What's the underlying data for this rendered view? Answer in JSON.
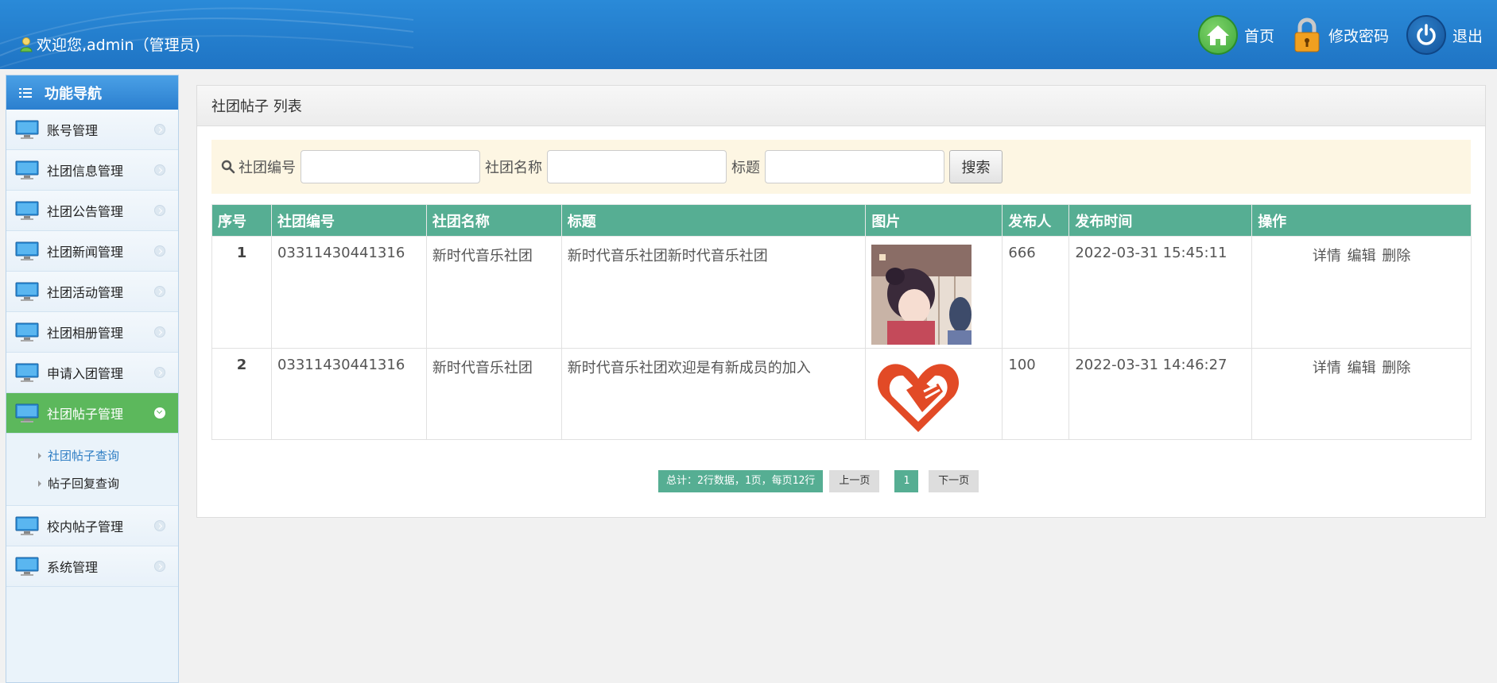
{
  "header": {
    "welcome": "欢迎您,admin（管理员)",
    "nav": [
      {
        "label": "首页",
        "icon": "home-icon"
      },
      {
        "label": "修改密码",
        "icon": "lock-icon"
      },
      {
        "label": "退出",
        "icon": "power-icon"
      }
    ]
  },
  "sidebar": {
    "title": "功能导航",
    "items": [
      {
        "label": "账号管理"
      },
      {
        "label": "社团信息管理"
      },
      {
        "label": "社团公告管理"
      },
      {
        "label": "社团新闻管理"
      },
      {
        "label": "社团活动管理"
      },
      {
        "label": "社团相册管理"
      },
      {
        "label": "申请入团管理"
      },
      {
        "label": "社团帖子管理"
      },
      {
        "label": "校内帖子管理"
      },
      {
        "label": "系统管理"
      }
    ],
    "sub_items": [
      {
        "label": "社团帖子查询"
      },
      {
        "label": "帖子回复查询"
      }
    ]
  },
  "panel": {
    "title": "社团帖子 列表"
  },
  "search": {
    "label_code": "社团编号",
    "label_name": "社团名称",
    "label_title": "标题",
    "value_code": "",
    "value_name": "",
    "value_title": "",
    "button": "搜索"
  },
  "table": {
    "headers": [
      "序号",
      "社团编号",
      "社团名称",
      "标题",
      "图片",
      "发布人",
      "发布时间",
      "操作"
    ],
    "rows": [
      {
        "idx": "1",
        "code": "03311430441316",
        "name": "新时代音乐社团",
        "title": "新时代音乐社团新时代音乐社团",
        "publisher": "666",
        "time": "2022-03-31 15:45:11"
      },
      {
        "idx": "2",
        "code": "03311430441316",
        "name": "新时代音乐社团",
        "title": "新时代音乐社团欢迎是有新成员的加入",
        "publisher": "100",
        "time": "2022-03-31 14:46:27"
      }
    ],
    "ops": {
      "detail": "详情",
      "edit": "编辑",
      "delete": "删除"
    }
  },
  "pager": {
    "summary": "总计：2行数据，1页，每页12行",
    "prev": "上一页",
    "page": "1",
    "next": "下一页"
  },
  "colors": {
    "header_blue": "#1f74c4",
    "table_header": "#56ae93",
    "active_menu": "#5cb85c",
    "search_bg": "#fdf6e3"
  }
}
